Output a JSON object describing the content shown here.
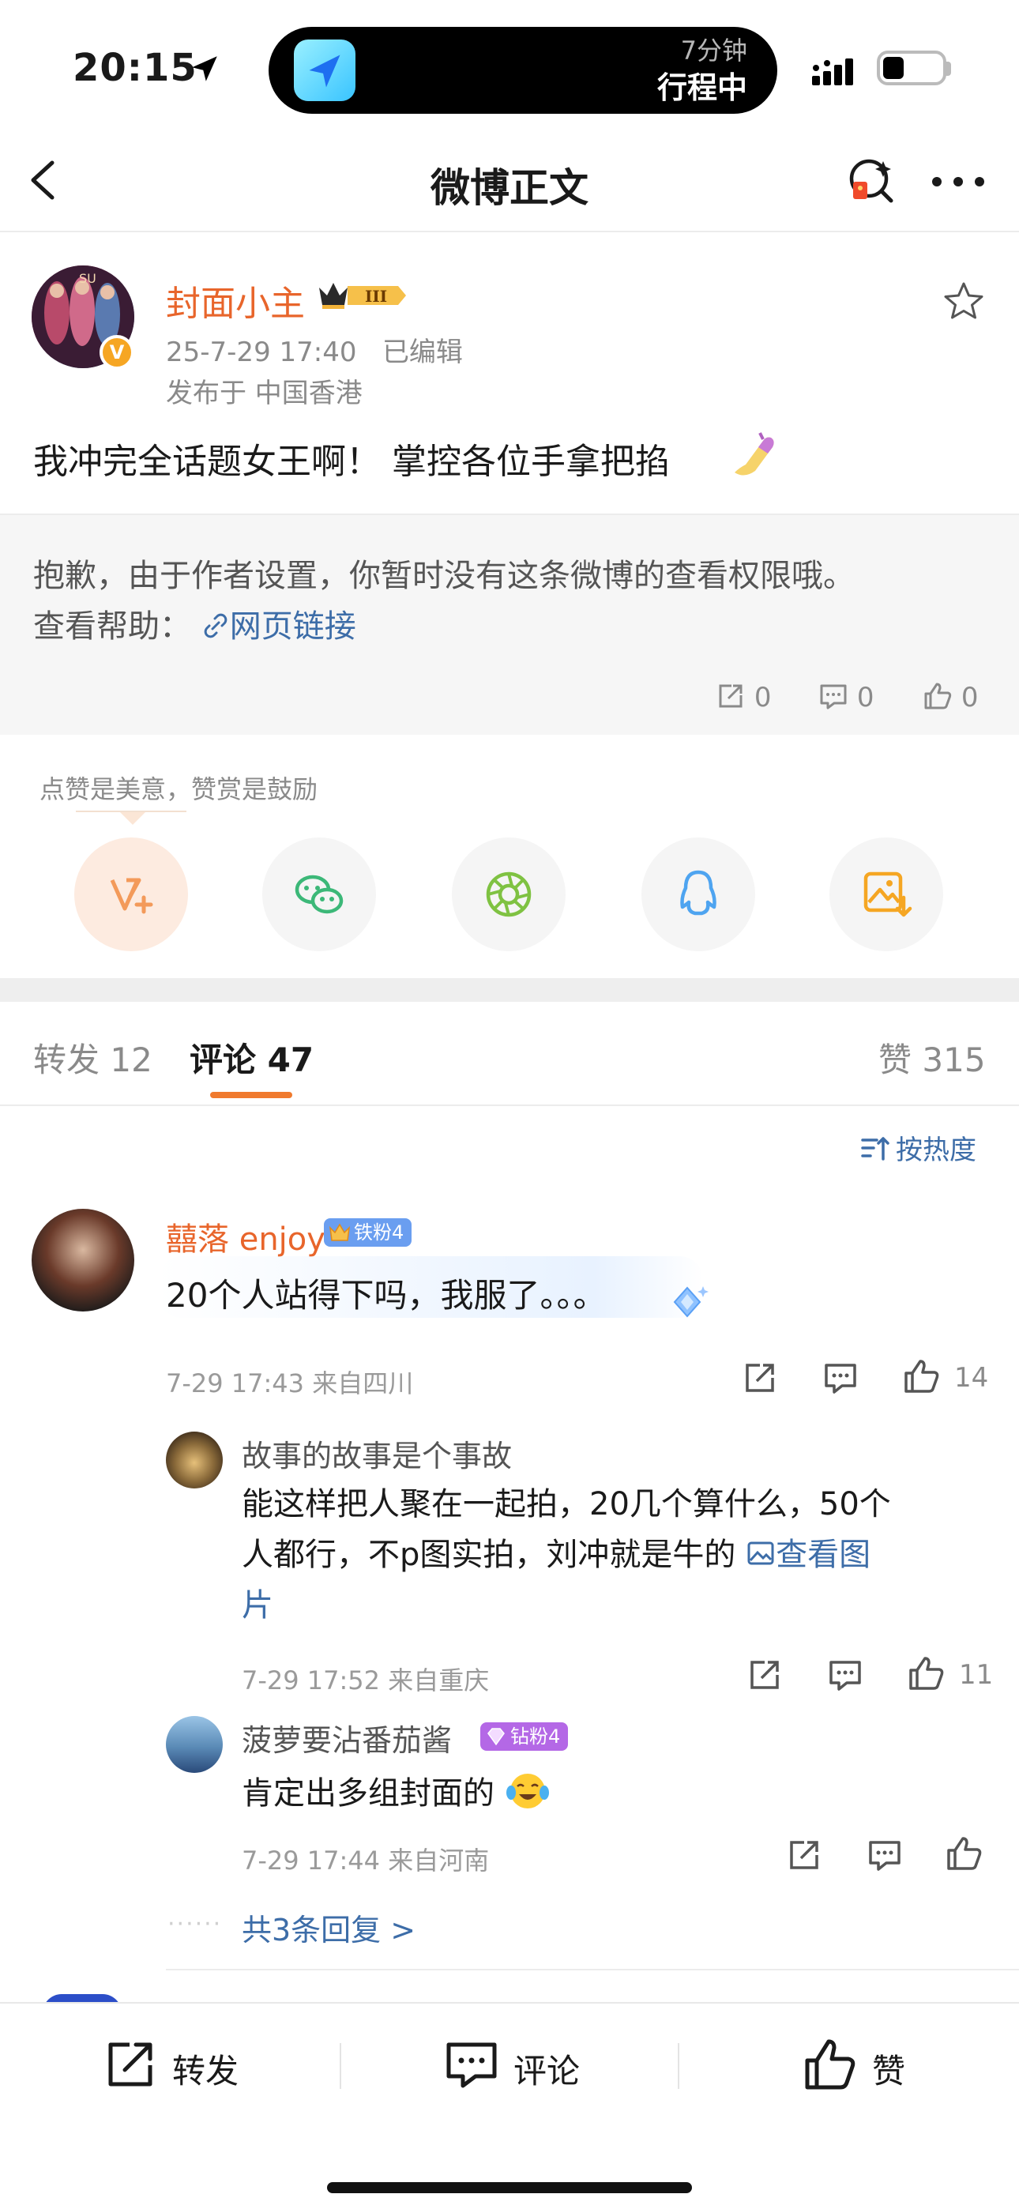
{
  "status_bar": {
    "time": "20:15",
    "island_sub": "7分钟",
    "island_main": "行程中"
  },
  "nav": {
    "title": "微博正文"
  },
  "post": {
    "author": "封面小主",
    "rank_badge": "III",
    "verified_badge": "V",
    "timestamp": "25-7-29 17:40",
    "edited_label": "已编辑",
    "location": "发布于 中国香港",
    "text": "我冲完全话题女王啊！ 掌控各位手拿把掐"
  },
  "restricted": {
    "message": "抱歉，由于作者设置，你暂时没有这条微博的查看权限哦。",
    "help_prefix": "查看帮助：",
    "help_link": "网页链接",
    "repost_count": "0",
    "comment_count": "0",
    "like_count": "0"
  },
  "reward": {
    "text": "点赞是美意，赞赏是鼓励"
  },
  "share_targets": [
    "reward-icon",
    "wechat-icon",
    "moments-icon",
    "qq-icon",
    "save-image-icon"
  ],
  "tabs": {
    "repost_label": "转发",
    "repost_count": "12",
    "comment_label": "评论",
    "comment_count": "47",
    "like_label": "赞",
    "like_count": "315"
  },
  "sort_label": "按热度",
  "comments": [
    {
      "user": "囍落 enjoy",
      "badge": "铁粉4",
      "text": "20个人站得下吗，我服了。。。",
      "meta": "7-29 17:43  来自四川",
      "likes": "14",
      "replies": [
        {
          "user": "故事的故事是个事故",
          "text_line1": "能这样把人聚在一起拍，20几个算什么，50个",
          "text_line2": "人都行，不p图实拍，刘冲就是牛的",
          "image_link": "查看图",
          "text_line3": "片",
          "meta": "7-29 17:52  来自重庆",
          "likes": "11"
        },
        {
          "user": "菠萝要沾番茄酱",
          "badge": "钻粉4",
          "text": "肯定出多组封面的",
          "meta": "7-29 17:44  来自河南",
          "likes": ""
        }
      ],
      "more_replies": "共3条回复 >"
    }
  ],
  "bottom_bar": {
    "repost": "转发",
    "comment": "评论",
    "like": "赞"
  },
  "colors": {
    "accent_orange": "#e8652b",
    "link_blue": "#3d6da8",
    "tab_indicator": "#f07a2e"
  }
}
